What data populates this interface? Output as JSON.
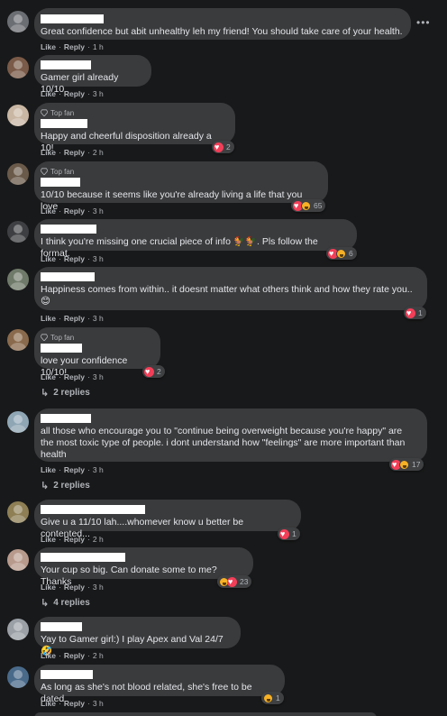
{
  "common": {
    "like": "Like",
    "reply": "Reply",
    "dot": "·",
    "top_fan": "Top fan",
    "more": "•••"
  },
  "comments": [
    {
      "text": "Great confidence but abit unhealthy leh my friend! You should take care of your health.",
      "time": "1 h"
    },
    {
      "text": "Gamer girl already 10/10",
      "time": "3 h"
    },
    {
      "text": "Happy and cheerful disposition already a 10!",
      "time": "2 h",
      "reactions": "2"
    },
    {
      "text": "10/10 because it seems like you're already living a life that you love",
      "time": "3 h",
      "reactions": "65"
    },
    {
      "text": "I think you're missing one crucial piece of info 🐓🐓. Pls follow the format.",
      "time": "3 h",
      "reactions": "6"
    },
    {
      "text": "Happiness comes from within.. it doesnt matter what others think and how they rate you..\n😊",
      "time": "3 h",
      "reactions": "1"
    },
    {
      "text": "love your confidence 10/10!",
      "time": "3 h",
      "reactions": "2",
      "replies": "2 replies"
    },
    {
      "text": "all those who encourage you to \"continue being overweight because you're happy\" are\nthe most toxic type of people. i dont understand how \"feelings\" are more important than\nhealth",
      "time": "3 h",
      "reactions": "17",
      "replies": "2 replies"
    },
    {
      "text": "Give u a 11/10 lah....whomever know u better be contented...",
      "time": "2 h",
      "reactions": "1"
    },
    {
      "text": "Your cup so big. Can donate some to me? Thanks",
      "time": "3 h",
      "reactions": "23",
      "replies": "4 replies"
    },
    {
      "text": "Yay to Gamer girl:) I play Apex and Val 24/7🤣",
      "time": "2 h"
    },
    {
      "text": "As long as she's not blood related, she's free to be dated",
      "time": "3 h",
      "reactions": "1"
    }
  ]
}
